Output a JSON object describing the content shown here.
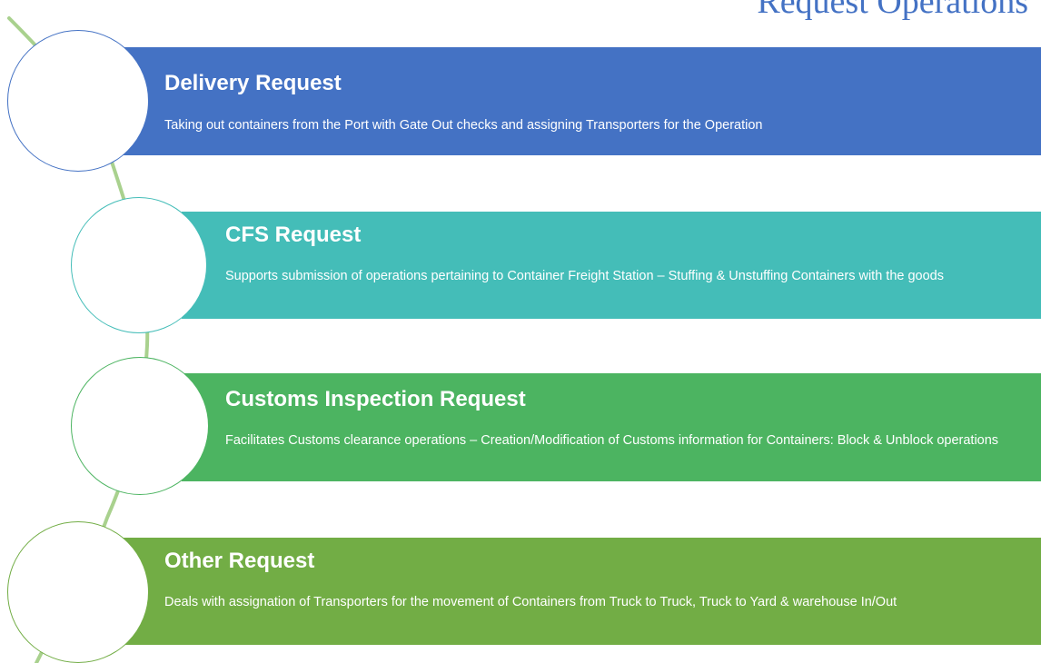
{
  "title": "Request Operations",
  "colors": {
    "title": "#4472c4",
    "connector": "#a9d18e",
    "band_1": "#4472c4",
    "band_2": "#44bdb8",
    "band_3": "#4cb461",
    "band_4": "#72ad45"
  },
  "items": [
    {
      "title": "Delivery Request",
      "description": "Taking out containers from the Port with Gate Out checks and assigning Transporters for the Operation"
    },
    {
      "title": "CFS Request",
      "description": "Supports submission of operations pertaining to Container Freight Station – Stuffing & Unstuffing Containers with the goods"
    },
    {
      "title": "Customs Inspection Request",
      "description": "Facilitates Customs clearance operations – Creation/Modification of Customs information for Containers: Block & Unblock operations"
    },
    {
      "title": "Other Request",
      "description": "Deals with assignation of Transporters for the movement of Containers from Truck to Truck, Truck to Yard & warehouse In/Out"
    }
  ]
}
